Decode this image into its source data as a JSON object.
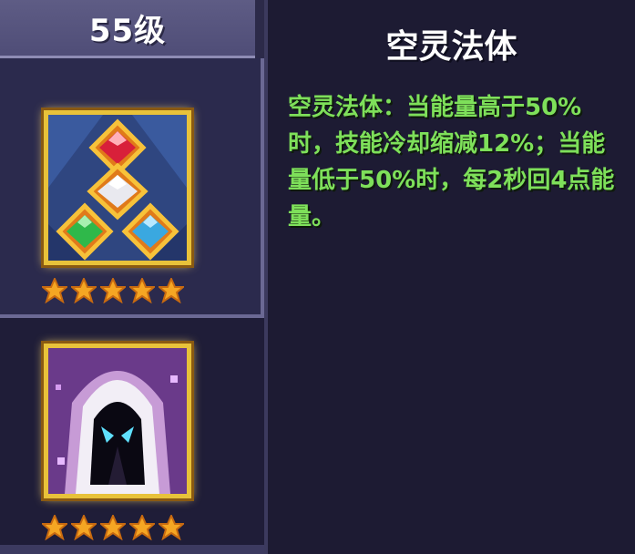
{
  "level": {
    "label": "55级"
  },
  "skills": [
    {
      "name": "mana-crystal-skill",
      "stars": 5,
      "selected": true
    },
    {
      "name": "hooded-mage-skill",
      "stars": 5,
      "selected": false
    }
  ],
  "detail": {
    "title": "空灵法体",
    "description": "空灵法体：当能量高于50%时，技能冷却缩减12%；当能量低于50%时，每2秒回4点能量。"
  },
  "colors": {
    "description": "#7ee05a",
    "frame": "#e8c23a",
    "header": "#5e5c85",
    "background": "#1c1a33"
  },
  "icons": [
    "crystal-triangle-icon",
    "hooded-mage-icon",
    "star-icon"
  ]
}
